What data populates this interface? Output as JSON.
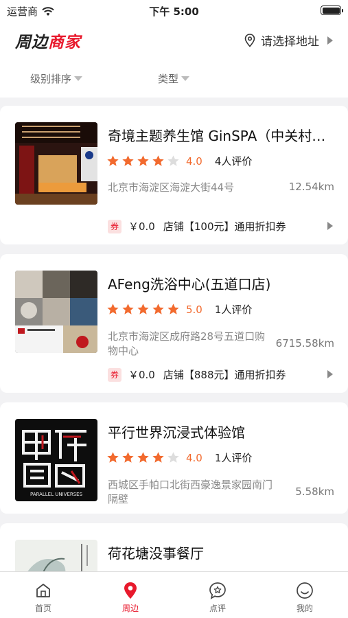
{
  "status_bar": {
    "carrier": "运营商",
    "time": "下午 5:00"
  },
  "header": {
    "logo_part1": "周边",
    "logo_part2": "商家",
    "address_prompt": "请选择地址"
  },
  "filters": [
    {
      "label": "级别排序"
    },
    {
      "label": "类型"
    }
  ],
  "merchants": [
    {
      "name": "奇境主题养生馆 GinSPA（中关村店）",
      "rating": 4.0,
      "score": "4.0",
      "reviews": "4人评价",
      "address": "北京市海淀区海淀大街44号",
      "distance": "12.54km",
      "coupon_tag": "券",
      "coupon_price": "￥0.0",
      "coupon_desc": "店铺【100元】通用折扣券"
    },
    {
      "name": "AFeng洗浴中心(五道口店)",
      "rating": 5.0,
      "score": "5.0",
      "reviews": "1人评价",
      "address": "北京市海淀区成府路28号五道口购物中心",
      "distance": "6715.58km",
      "coupon_tag": "券",
      "coupon_price": "￥0.0",
      "coupon_desc": "店铺【888元】通用折扣券"
    },
    {
      "name": "平行世界沉浸式体验馆",
      "rating": 4.0,
      "score": "4.0",
      "reviews": "1人评价",
      "address": "西城区手帕口北街西豪逸景家园南门隔壁",
      "distance": "5.58km"
    },
    {
      "name": "荷花塘没事餐厅"
    }
  ],
  "thumb_text": {
    "parallel_caption": "PARALLEL UNIVERSES"
  },
  "tabbar": [
    {
      "label": "首页",
      "icon": "home-icon"
    },
    {
      "label": "周边",
      "icon": "location-pin-icon"
    },
    {
      "label": "点评",
      "icon": "star-chat-icon"
    },
    {
      "label": "我的",
      "icon": "smile-icon"
    }
  ],
  "colors": {
    "accent": "#e8192c",
    "star": "#f26a2e",
    "star_empty": "#dddddd"
  }
}
